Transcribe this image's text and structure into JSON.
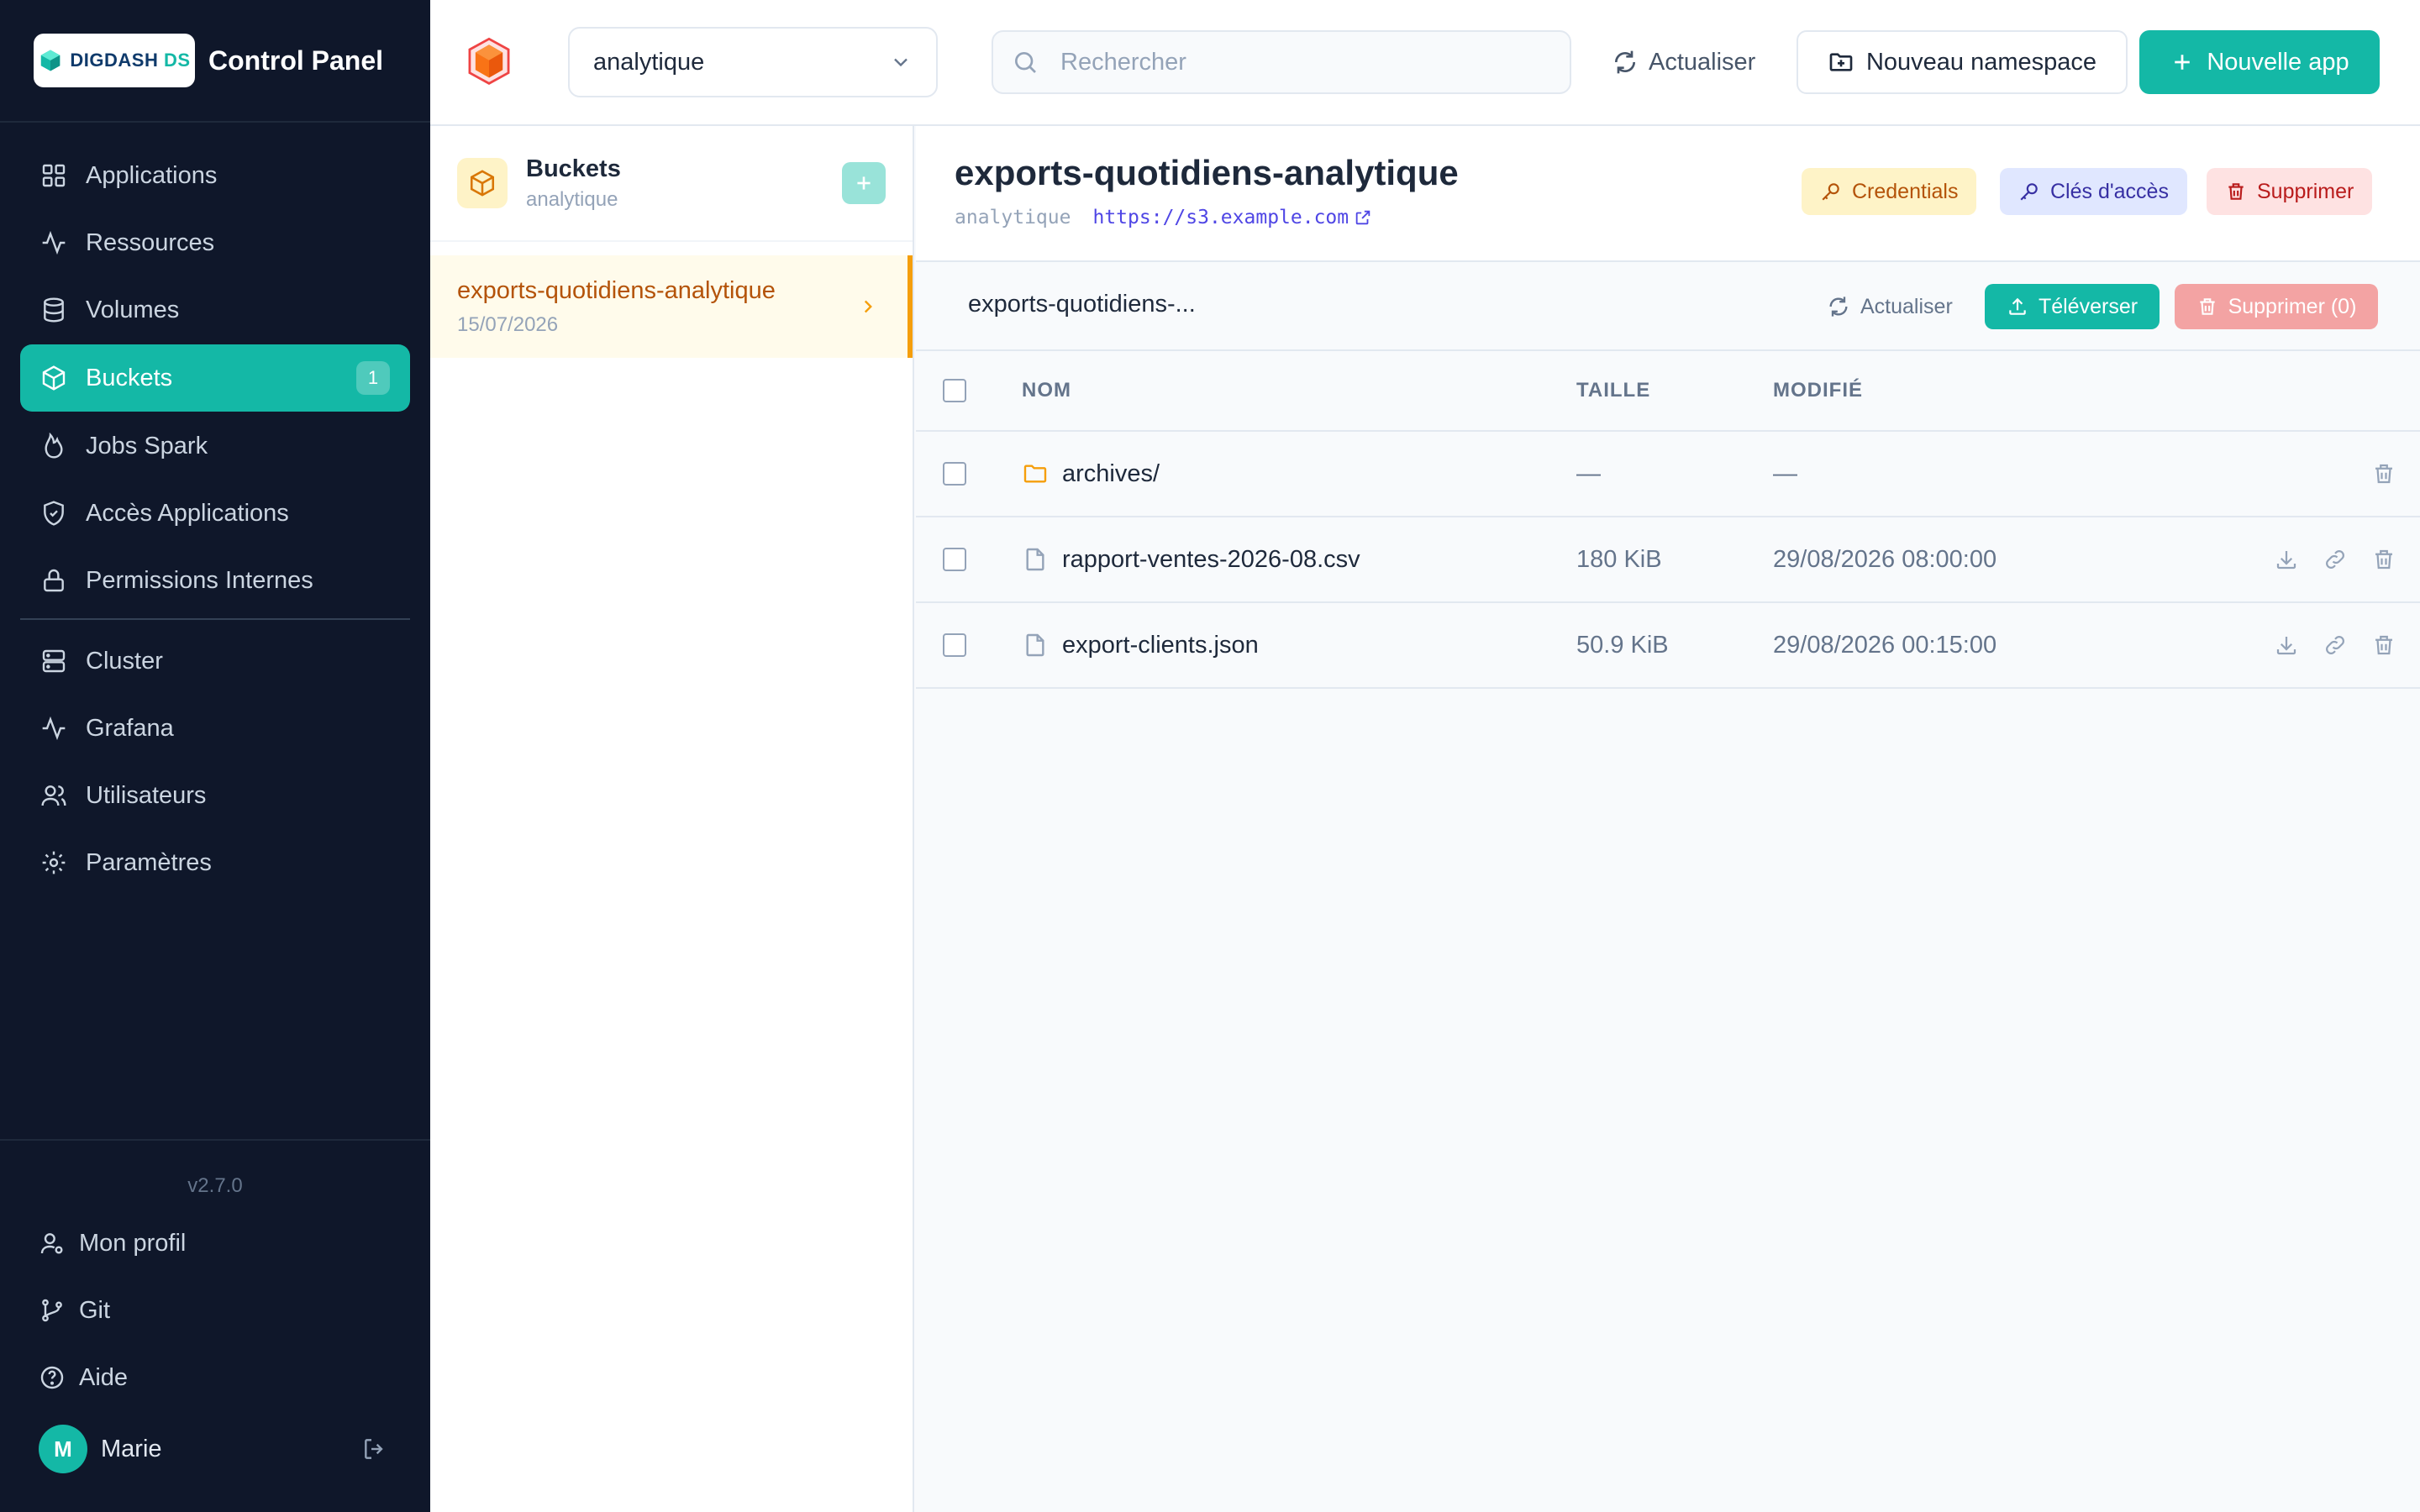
{
  "app": {
    "title": "Control Panel",
    "logo_text_a": "DIGDASH",
    "logo_text_b": "DS",
    "version": "v2.7.0"
  },
  "sidebar": {
    "items": [
      {
        "label": "Applications",
        "icon": "grid-icon"
      },
      {
        "label": "Ressources",
        "icon": "activity-icon"
      },
      {
        "label": "Volumes",
        "icon": "database-icon"
      },
      {
        "label": "Buckets",
        "icon": "box-icon",
        "active": true,
        "badge": "1"
      },
      {
        "label": "Jobs Spark",
        "icon": "flame-icon"
      },
      {
        "label": "Accès Applications",
        "icon": "shield-icon"
      },
      {
        "label": "Permissions Internes",
        "icon": "lock-icon"
      },
      {
        "label": "Cluster",
        "icon": "server-icon"
      },
      {
        "label": "Grafana",
        "icon": "activity-icon"
      },
      {
        "label": "Utilisateurs",
        "icon": "users-icon"
      },
      {
        "label": "Paramètres",
        "icon": "gear-icon"
      }
    ],
    "bottom": [
      {
        "label": "Mon profil",
        "icon": "user-icon"
      },
      {
        "label": "Git",
        "icon": "git-branch-icon"
      },
      {
        "label": "Aide",
        "icon": "help-icon"
      }
    ],
    "user": {
      "initial": "M",
      "name": "Marie"
    }
  },
  "topbar": {
    "namespace": "analytique",
    "search_placeholder": "Rechercher",
    "refresh_label": "Actualiser",
    "new_namespace_label": "Nouveau namespace",
    "new_app_label": "Nouvelle app"
  },
  "bucket_list": {
    "title": "Buckets",
    "subtitle": "analytique",
    "items": [
      {
        "name": "exports-quotidiens-analytique",
        "date": "15/07/2026"
      }
    ]
  },
  "detail": {
    "title": "exports-quotidiens-analytique",
    "namespace": "analytique",
    "url": "https://s3.example.com",
    "credentials_label": "Credentials",
    "access_keys_label": "Clés d'accès",
    "delete_label": "Supprimer",
    "toolbar": {
      "path": "exports-quotidiens-...",
      "refresh_label": "Actualiser",
      "upload_label": "Téléverser",
      "delete_selected_label": "Supprimer (0)"
    },
    "table": {
      "columns": {
        "name": "NOM",
        "size": "TAILLE",
        "modified": "MODIFIÉ"
      },
      "rows": [
        {
          "name": "archives/",
          "type": "folder",
          "size": "—",
          "modified": "—"
        },
        {
          "name": "rapport-ventes-2026-08.csv",
          "type": "file",
          "size": "180 KiB",
          "modified": "29/08/2026 08:00:00"
        },
        {
          "name": "export-clients.json",
          "type": "file",
          "size": "50.9 KiB",
          "modified": "29/08/2026 00:15:00"
        }
      ]
    }
  },
  "colors": {
    "sidebar_bg": "#0f172a",
    "accent": "#14b8a6",
    "bucket_accent": "#f59e0b",
    "danger": "#b91c1c"
  }
}
